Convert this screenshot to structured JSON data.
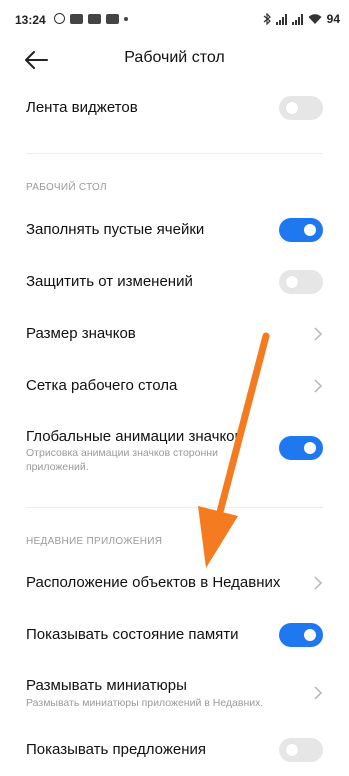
{
  "statusbar": {
    "time": "13:24",
    "battery": "94"
  },
  "header": {
    "title": "Рабочий стол"
  },
  "rows": {
    "widgets": {
      "label": "Лента виджетов",
      "on": false
    },
    "fill_cells": {
      "label": "Заполнять пустые ячейки",
      "on": true
    },
    "protect": {
      "label": "Защитить от изменений",
      "on": false
    },
    "icon_size": {
      "label": "Размер значков"
    },
    "grid": {
      "label": "Сетка рабочего стола"
    },
    "global_anim": {
      "label": "Глобальные анимации значков",
      "sub": "Отрисовка анимации значков сторонни приложений.",
      "on": true
    },
    "recent_layout": {
      "label": "Расположение объектов в Недавних"
    },
    "memory": {
      "label": "Показывать состояние памяти",
      "on": true
    },
    "blur": {
      "label": "Размывать миниатюры",
      "sub": "Размывать миниатюры приложений в Недавних."
    },
    "suggestions": {
      "label": "Показывать предложения",
      "on": false
    }
  },
  "sections": {
    "desktop": "РАБОЧИЙ СТОЛ",
    "recent": "НЕДАВНИЕ ПРИЛОЖЕНИЯ"
  },
  "colors": {
    "toggle_on": "#1f78f0",
    "toggle_off": "#e6e6e6",
    "annotation_arrow": "#f47b20"
  }
}
